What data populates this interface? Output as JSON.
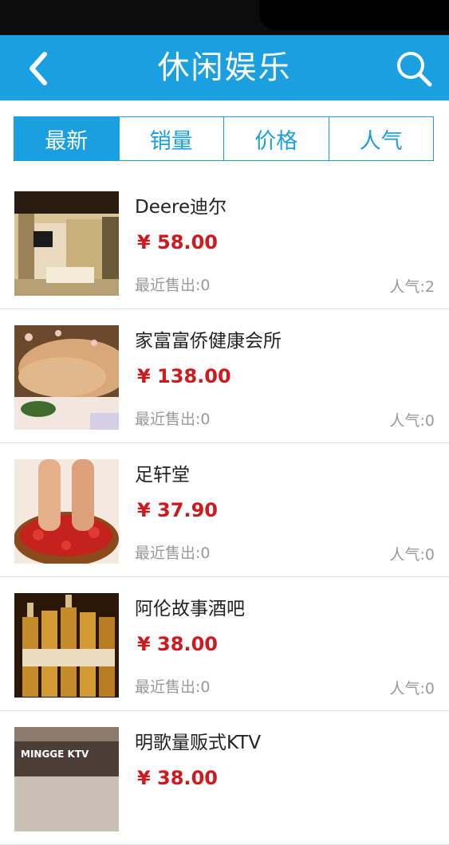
{
  "header": {
    "title": "休闲娱乐",
    "back_icon": "back-chevron-icon",
    "search_icon": "search-icon",
    "color": "#1a9fe0"
  },
  "tabs": [
    {
      "label": "最新",
      "active": true
    },
    {
      "label": "销量",
      "active": false
    },
    {
      "label": "价格",
      "active": false
    },
    {
      "label": "人气",
      "active": false
    }
  ],
  "items": [
    {
      "name": "Deere迪尔",
      "price": "¥ 58.00",
      "sold": "最近售出:0",
      "popularity": "人气:2",
      "image": "storefront-photo"
    },
    {
      "name": "家富富侨健康会所",
      "price": "¥ 138.00",
      "sold": "最近售出:0",
      "popularity": "人气:0",
      "image": "massage-photo"
    },
    {
      "name": "足轩堂",
      "price": "¥ 37.90",
      "sold": "最近售出:0",
      "popularity": "人气:0",
      "image": "foot-spa-photo"
    },
    {
      "name": "阿伦故事酒吧",
      "price": "¥ 38.00",
      "sold": "最近售出:0",
      "popularity": "人气:0",
      "image": "beer-bottles-photo"
    },
    {
      "name": "明歌量贩式KTV",
      "price": "¥ 38.00",
      "sold": "",
      "popularity": "",
      "image": "ktv-sign-photo",
      "image_text": "MINGGE KTV"
    }
  ],
  "colors": {
    "accent": "#1a9fe0",
    "price": "#d0181d",
    "muted": "#999999"
  }
}
